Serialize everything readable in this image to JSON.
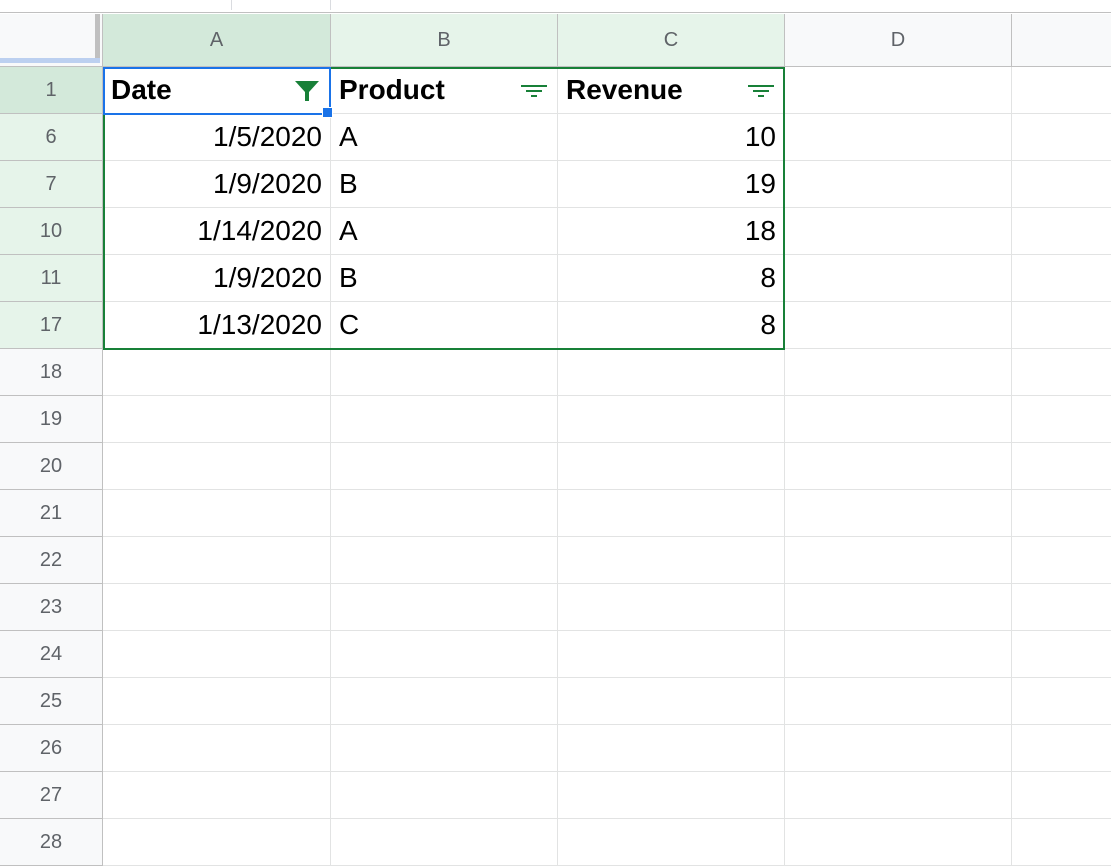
{
  "colors": {
    "selected_header_bg": "#d3e9da",
    "range_header_bg": "#e6f4ea",
    "filter_green": "#188038",
    "selection_blue": "#1a73e8"
  },
  "columns": [
    "A",
    "B",
    "C",
    "D"
  ],
  "header_row": {
    "row_label": "1",
    "cells": [
      {
        "text": "Date",
        "filter": "active-filter-icon"
      },
      {
        "text": "Product",
        "filter": "filter-lines-icon"
      },
      {
        "text": "Revenue",
        "filter": "filter-lines-icon"
      }
    ]
  },
  "rows": [
    {
      "label": "6",
      "date": "1/5/2020",
      "product": "A",
      "revenue": "10"
    },
    {
      "label": "7",
      "date": "1/9/2020",
      "product": "B",
      "revenue": "19"
    },
    {
      "label": "10",
      "date": "1/14/2020",
      "product": "A",
      "revenue": "18"
    },
    {
      "label": "11",
      "date": "1/9/2020",
      "product": "B",
      "revenue": "8"
    },
    {
      "label": "17",
      "date": "1/13/2020",
      "product": "C",
      "revenue": "8"
    }
  ],
  "empty_rows": [
    "18",
    "19",
    "20",
    "21",
    "22",
    "23",
    "24",
    "25",
    "26",
    "27",
    "28"
  ]
}
